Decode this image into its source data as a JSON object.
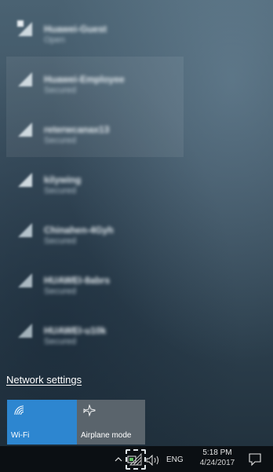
{
  "networks": [
    {
      "name": "Huawei-Guest",
      "status": "Open"
    },
    {
      "name": "Huawei-Employee",
      "status": "Secured"
    },
    {
      "name": "reterwcanax13",
      "status": "Secured"
    },
    {
      "name": "kilywing",
      "status": "Secured"
    },
    {
      "name": "Chinahen-4Gyh",
      "status": "Secured"
    },
    {
      "name": "HUAWEI-8abrs",
      "status": "Secured"
    },
    {
      "name": "HUAWEI-u10k",
      "status": "Secured"
    }
  ],
  "network_settings_label": "Network settings",
  "quick_actions": [
    {
      "label": "Wi-Fi",
      "icon": "wifi-icon",
      "color": "#2d86d0"
    },
    {
      "label": "Airplane mode",
      "icon": "airplane-icon",
      "color": "#5a646c"
    }
  ],
  "taskbar": {
    "language": "ENG",
    "time": "5:18 PM",
    "date": "4/24/2017"
  }
}
